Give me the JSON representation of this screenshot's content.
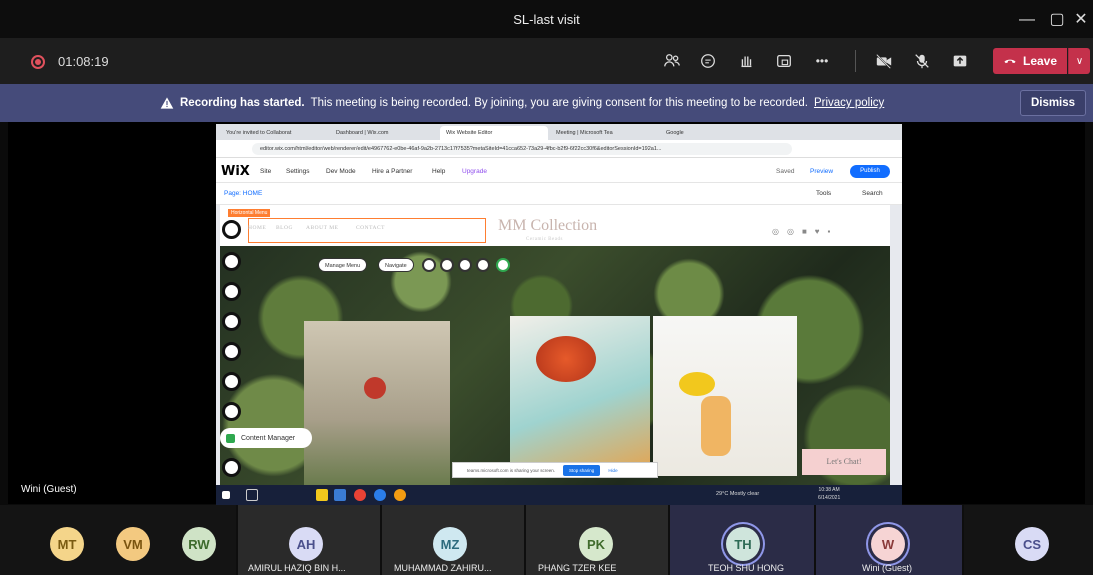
{
  "window": {
    "title": "SL-last visit",
    "minimize": "—",
    "restore": "▢",
    "close": "✕"
  },
  "toolbar": {
    "timer": "01:08:19",
    "leave_label": "Leave",
    "more_label": "•••"
  },
  "banner": {
    "bold": "Recording has started.",
    "text": "This meeting is being recorded. By joining, you are giving consent for this meeting to be recorded.",
    "link": "Privacy policy",
    "dismiss": "Dismiss"
  },
  "browser": {
    "tabs": [
      "You're invited to Collaborat",
      "Dashboard | Wix.com",
      "Wix Website Editor",
      "Meeting | Microsoft Tea",
      "Google"
    ],
    "url": "editor.wix.com/html/editor/web/renderer/edit/e4967762-e0be-46af-9a2b-2713c17f7535?metaSiteId=41cca652-73a29-4fbc-b2f9-6f22cc30f6&editorSessionId=192a1..."
  },
  "wix": {
    "logo": "WiX",
    "menu": [
      "Site",
      "Settings",
      "Dev Mode",
      "Hire a Partner",
      "Help",
      "Upgrade"
    ],
    "saved": "Saved",
    "preview": "Preview",
    "publish": "Publish",
    "page": "Page: HOME",
    "tools": "Tools",
    "search": "Search",
    "horizontal_menu_tag": "Horizontal Menu",
    "nav": [
      "HOME",
      "BLOG",
      "ABOUT ME",
      "CONTACT"
    ],
    "brand": "MM Collection",
    "brand_sub": "Ceramic Beads",
    "manage_menu": "Manage Menu",
    "navigate": "Navigate",
    "content_manager": "Content Manager",
    "chat": "Let's Chat!",
    "share_notice": "teams.microsoft.com is sharing your screen.",
    "stop_sharing": "Stop sharing",
    "hide": "Hide"
  },
  "taskbar": {
    "weather": "29°C  Mostly clear",
    "time": "10:38 AM",
    "date": "6/14/2021"
  },
  "presenter": "Wini (Guest)",
  "participants": [
    {
      "initials": "MT",
      "name": "",
      "bg": "#f4d58a",
      "fg": "#7a5b12"
    },
    {
      "initials": "VM",
      "name": "",
      "bg": "#f3c980",
      "fg": "#7a5410"
    },
    {
      "initials": "RW",
      "name": "",
      "bg": "#cfe3c6",
      "fg": "#3d6b2c"
    },
    {
      "initials": "AH",
      "name": "AMIRUL HAZIQ BIN H...",
      "bg": "#d9dbf5",
      "fg": "#4a4f8c"
    },
    {
      "initials": "MZ",
      "name": "MUHAMMAD ZAHIRU...",
      "bg": "#cfe8f0",
      "fg": "#2c6a7d"
    },
    {
      "initials": "PK",
      "name": "PHANG TZER KEE",
      "bg": "#d6e8cc",
      "fg": "#3f6b2b"
    },
    {
      "initials": "TH",
      "name": "TEOH SHU HONG",
      "bg": "#cfe5dc",
      "fg": "#2e6b56"
    },
    {
      "initials": "W",
      "name": "Wini (Guest)",
      "bg": "#f6d4d4",
      "fg": "#8a3a3a"
    },
    {
      "initials": "CS",
      "name": "",
      "bg": "#d9dbf5",
      "fg": "#4a4f8c"
    }
  ],
  "colors": {
    "banner": "#454b7a",
    "leave": "#c4314b",
    "wix_blue": "#116dff",
    "selection": "#fe7e31"
  }
}
